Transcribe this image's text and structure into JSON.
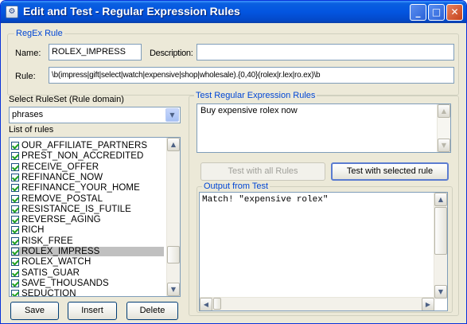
{
  "window": {
    "title": "Edit and Test - Regular Expression Rules",
    "app_icon": "regex-app-icon",
    "minimize_glyph": "_",
    "maximize_glyph": "□",
    "close_glyph": "✕"
  },
  "regex_rule": {
    "group_title": "RegEx Rule",
    "name_label": "Name:",
    "name_value": "ROLEX_IMPRESS",
    "description_label": "Description:",
    "description_value": "",
    "rule_label": "Rule:",
    "rule_value": "\\b(impress|gift|select|watch|expensive|shop|wholesale).{0,40}(rolex|r.lex|ro.ex)\\b"
  },
  "ruleset": {
    "label": "Select RuleSet (Rule domain)",
    "selected": "phrases",
    "list_label": "List of rules",
    "rules": [
      {
        "label": "OUR_AFFILIATE_PARTNERS",
        "checked": true
      },
      {
        "label": "PREST_NON_ACCREDITED",
        "checked": true
      },
      {
        "label": "RECEIVE_OFFER",
        "checked": true
      },
      {
        "label": "REFINANCE_NOW",
        "checked": true
      },
      {
        "label": "REFINANCE_YOUR_HOME",
        "checked": true
      },
      {
        "label": "REMOVE_POSTAL",
        "checked": true
      },
      {
        "label": "RESISTANCE_IS_FUTILE",
        "checked": true
      },
      {
        "label": "REVERSE_AGING",
        "checked": true
      },
      {
        "label": "RICH",
        "checked": true
      },
      {
        "label": "RISK_FREE",
        "checked": true
      },
      {
        "label": "ROLEX_IMPRESS",
        "checked": true,
        "selected": true
      },
      {
        "label": "ROLEX_WATCH",
        "checked": true
      },
      {
        "label": "SATIS_GUAR",
        "checked": true
      },
      {
        "label": "SAVE_THOUSANDS",
        "checked": true
      },
      {
        "label": "SEDUCTION",
        "checked": true
      }
    ],
    "buttons": {
      "save": "Save",
      "insert": "Insert",
      "delete": "Delete"
    }
  },
  "test": {
    "group_title": "Test Regular Expression Rules",
    "input_text": "Buy expensive rolex now",
    "test_all_label": "Test with all Rules",
    "test_selected_label": "Test with selected rule",
    "output_title": "Output from Test",
    "output_text": "Match! \"expensive rolex\""
  },
  "icons": {
    "dropdown": "chevron-down-icon",
    "scroll_up": "arrow-up-icon",
    "scroll_down": "arrow-down-icon",
    "scroll_left": "arrow-left-icon",
    "scroll_right": "arrow-right-icon"
  },
  "colors": {
    "titlebar": "#0355e0",
    "group_legend": "#0046d5",
    "window_face": "#ece9d8",
    "check_mark": "#21a121"
  }
}
